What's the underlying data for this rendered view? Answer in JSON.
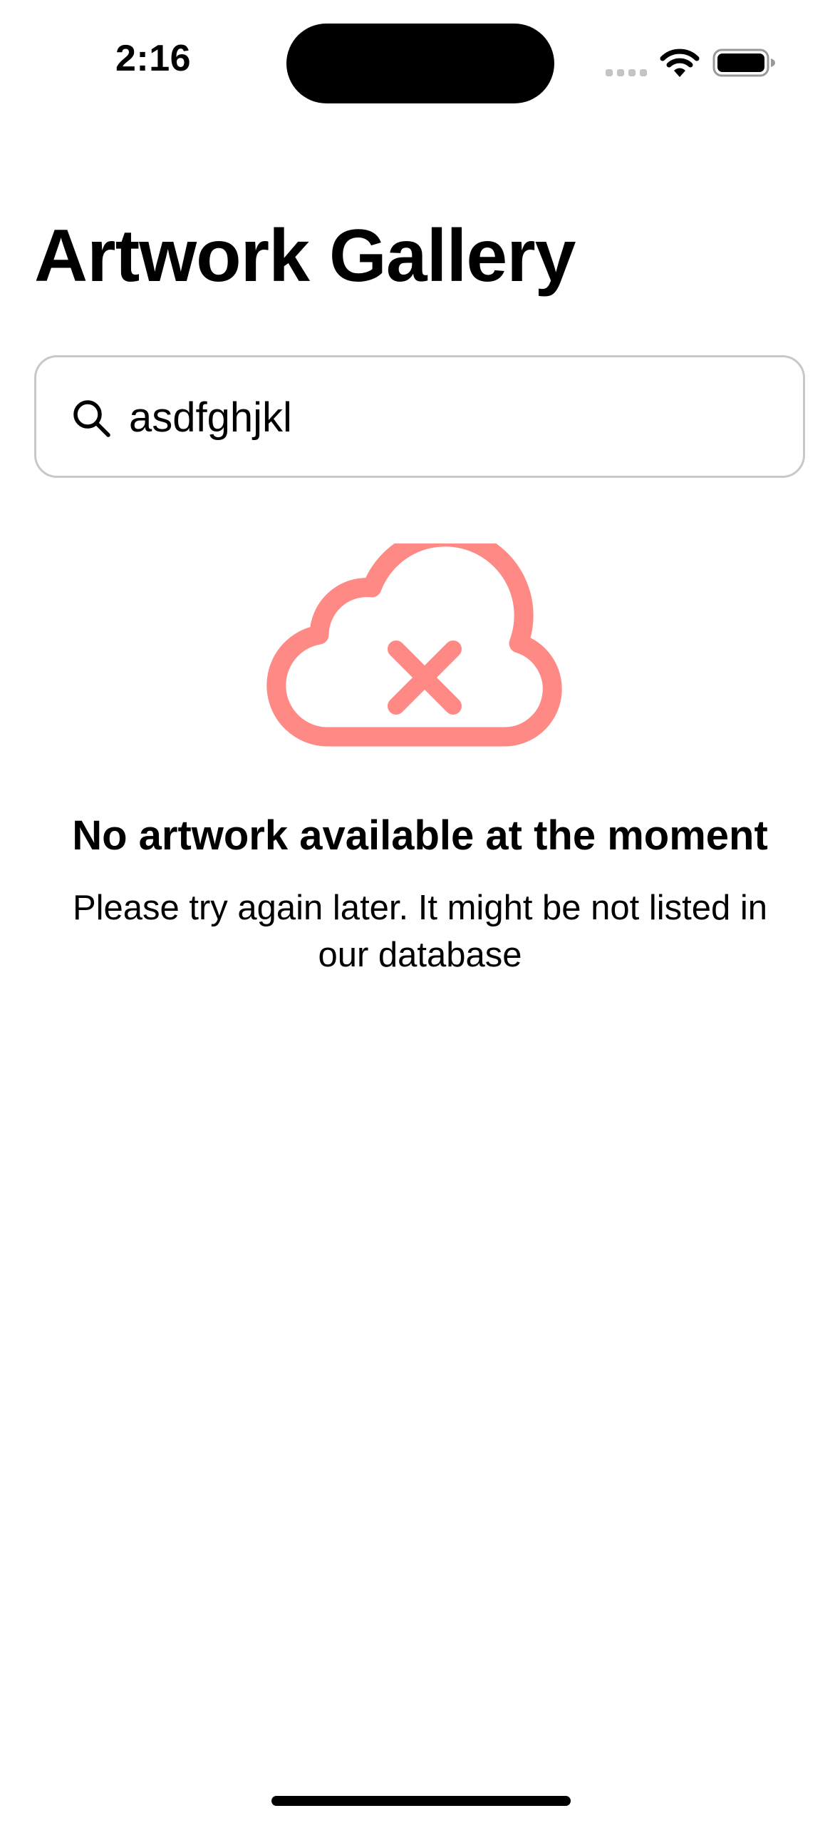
{
  "status_bar": {
    "time": "2:16",
    "icons": [
      "cellular-signal-icon",
      "wifi-icon",
      "battery-icon"
    ],
    "battery_level": 1.0
  },
  "header": {
    "title": "Artwork Gallery"
  },
  "search": {
    "value": "asdfghjkl",
    "icon": "search-icon"
  },
  "empty_state": {
    "icon": "cloud-error-icon",
    "icon_color": "#FF8A85",
    "heading": "No artwork available at the moment",
    "message": "Please try again later. It might be not listed in our database"
  }
}
